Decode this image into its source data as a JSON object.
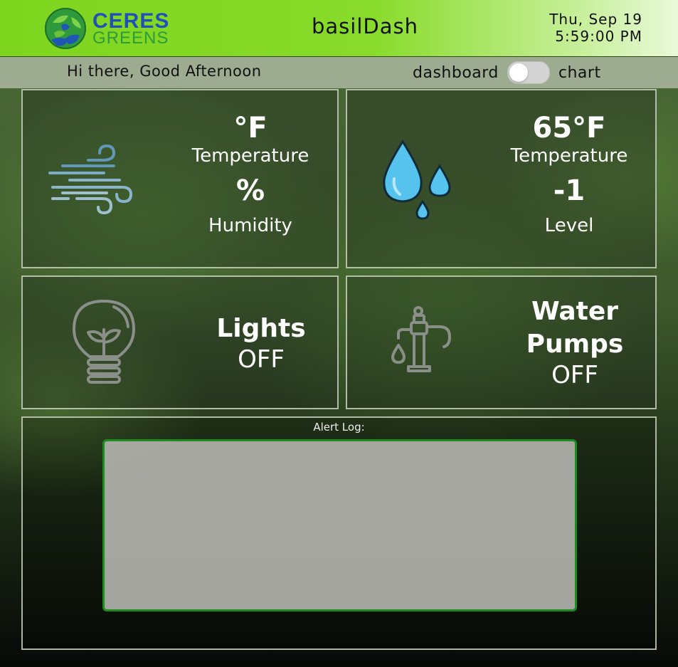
{
  "header": {
    "brand_line1": "CERES",
    "brand_line2": "GREENS",
    "app_title": "basilDash",
    "date": "Thu, Sep 19",
    "time": "5:59:00 PM"
  },
  "subbar": {
    "greeting": "Hi there, Good Afternoon",
    "toggle_left_label": "dashboard",
    "toggle_right_label": "chart",
    "toggle_state": "dashboard"
  },
  "cards": {
    "air": {
      "icon": "wind-icon",
      "temperature_value": "°F",
      "temperature_label": "Temperature",
      "humidity_value": "%",
      "humidity_label": "Humidity"
    },
    "water": {
      "icon": "water-drops-icon",
      "temperature_value": "65°F",
      "temperature_label": "Temperature",
      "level_value": "-1",
      "level_label": "Level"
    },
    "lights": {
      "icon": "lightbulb-plant-icon",
      "label": "Lights",
      "state": "OFF"
    },
    "pumps": {
      "icon": "water-pump-icon",
      "label_line1": "Water",
      "label_line2": "Pumps",
      "state": "OFF"
    }
  },
  "alert_log": {
    "title": "Alert Log:",
    "content": ""
  },
  "colors": {
    "header_green": "#7ed51e",
    "alert_border": "#1f8a1f",
    "drop_blue": "#56c3ef"
  }
}
